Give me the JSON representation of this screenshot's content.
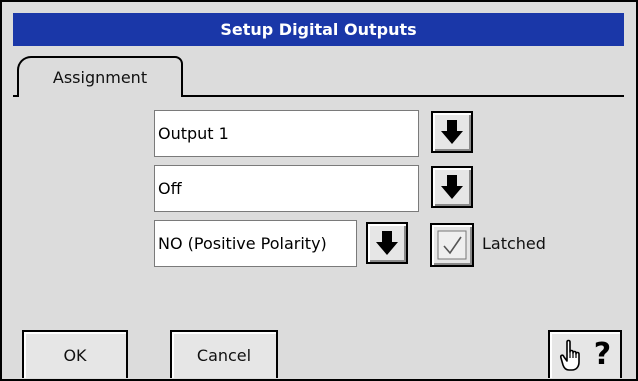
{
  "dialog": {
    "title": "Setup Digital Outputs"
  },
  "tabs": [
    {
      "label": "Assignment"
    }
  ],
  "assignment": {
    "output_select": {
      "value": "Output 1"
    },
    "source_select": {
      "value": "Off"
    },
    "polarity_select": {
      "value": "NO (Positive Polarity)"
    },
    "latched": {
      "label": "Latched",
      "checked": true
    }
  },
  "buttons": {
    "ok": "OK",
    "cancel": "Cancel",
    "help": "?"
  },
  "icons": {
    "dropdown": "arrow-down-icon",
    "check": "check-icon",
    "help": "pointing-hand-question-icon"
  },
  "colors": {
    "titlebar": "#1a37a8",
    "background": "#dcdcdc",
    "field": "#ffffff"
  }
}
